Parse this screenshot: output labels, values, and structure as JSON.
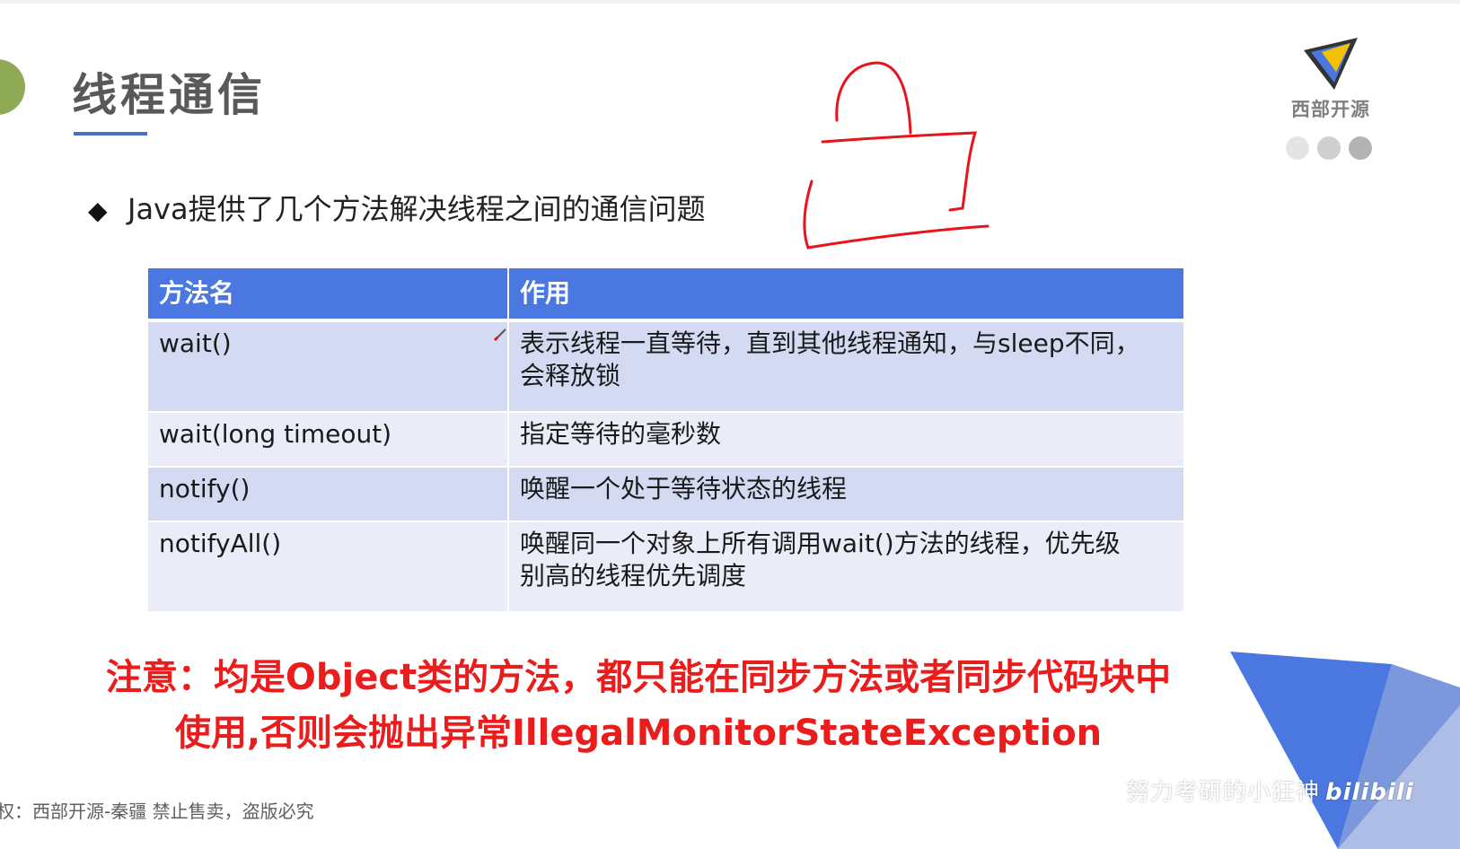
{
  "slide": {
    "title": "线程通信",
    "bullet": "Java提供了几个方法解决线程之间的通信问题",
    "bullet_symbol": "◆"
  },
  "logo": {
    "text": "西部开源",
    "colors": [
      "#4a78e0",
      "#f2c200",
      "#333333"
    ]
  },
  "table": {
    "headers": [
      "方法名",
      "作用"
    ],
    "rows": [
      {
        "method": "wait()",
        "desc_lines": [
          "表示线程一直等待，直到其他线程通知，与sleep不同，",
          "会释放锁"
        ]
      },
      {
        "method": "wait(long timeout)",
        "desc_lines": [
          "指定等待的毫秒数"
        ]
      },
      {
        "method": "notify()",
        "desc_lines": [
          "唤醒一个处于等待状态的线程"
        ]
      },
      {
        "method": "notifyAll()",
        "desc_lines": [
          "唤醒同一个对象上所有调用wait()方法的线程，优先级",
          "别高的线程优先调度"
        ]
      }
    ]
  },
  "note": {
    "line1": "注意：均是Object类的方法，都只能在同步方法或者同步代码块中",
    "line2": "使用,否则会抛出异常IllegalMonitorStateException",
    "color": "#ea1c1c"
  },
  "footer": {
    "text": "权：西部开源-秦疆    禁止售卖，盗版必究"
  },
  "watermark": {
    "text": "努力考研的小狂神",
    "brand": "bilibili"
  },
  "colors": {
    "header": "#4a78e0",
    "row_dark": "#d3daf2",
    "row_light": "#eaedf8",
    "accent_green": "#8faa54",
    "underline": "#4472c4"
  }
}
